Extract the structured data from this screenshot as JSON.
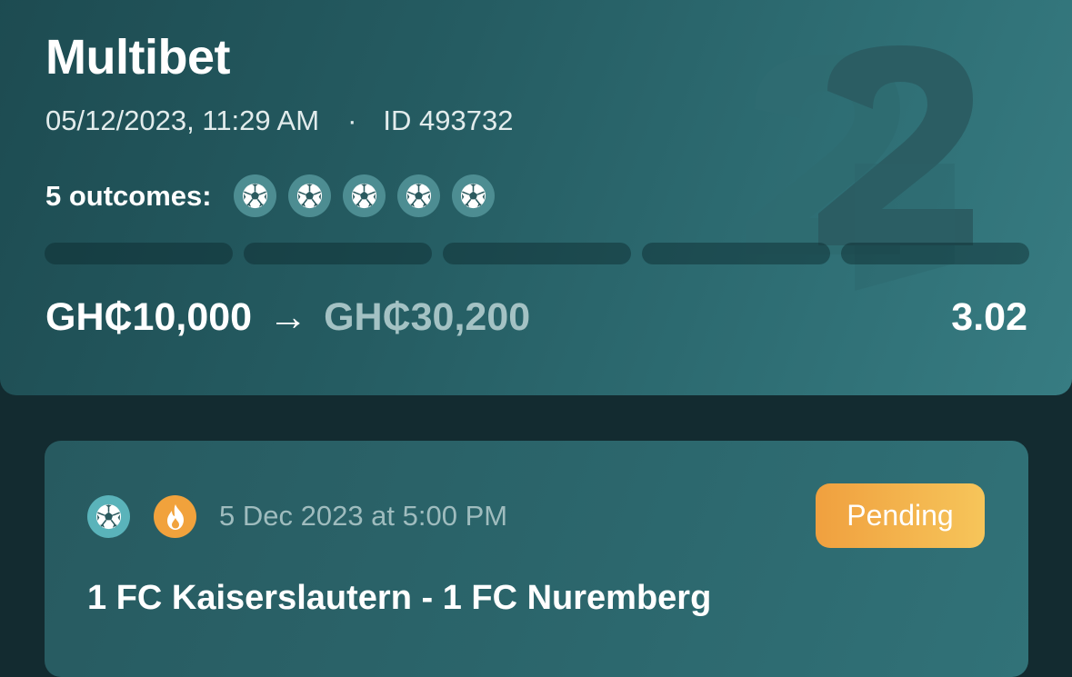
{
  "bet": {
    "title": "Multibet",
    "datetime": "05/12/2023, 11:29 AM",
    "separator": "·",
    "id_text": "ID 493732",
    "outcomes_label": "5 outcomes:",
    "outcome_count": 5,
    "stake": "GH₵10,000",
    "arrow": "→",
    "potential_payout": "GH₵30,200",
    "total_odds": "3.02"
  },
  "selection": {
    "sport_icon": "soccer-ball-icon",
    "badge_icon": "fire-icon",
    "match_time": "5 Dec 2023 at 5:00 PM",
    "status": "Pending",
    "match_name": "1 FC Kaiserslautern - 1 FC Nuremberg"
  },
  "colors": {
    "background": "#132b30",
    "card": "#2a6268",
    "pending_badge": "#f2ad47",
    "fire_badge": "#f1a23c",
    "ball_badge": "#5ab3ba"
  }
}
